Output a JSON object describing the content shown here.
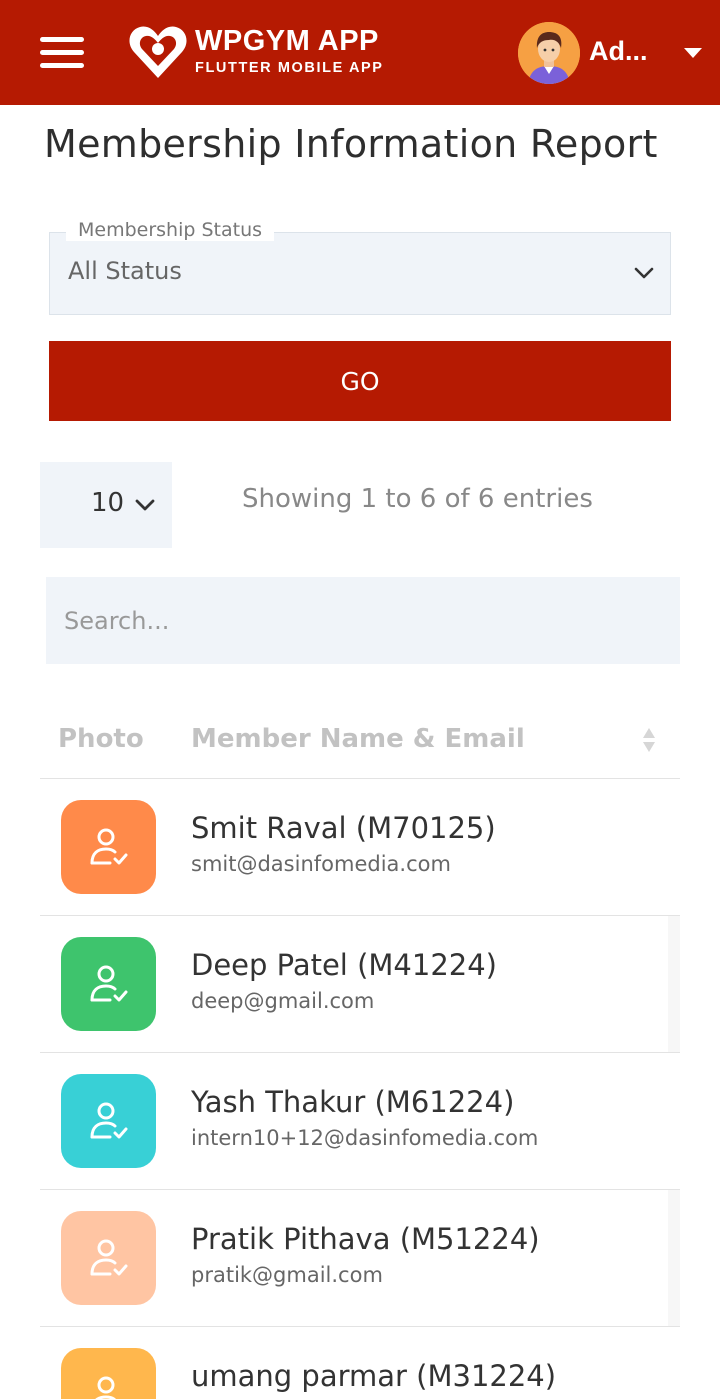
{
  "header": {
    "brand_title": "WPGYM APP",
    "brand_subtitle": "FLUTTER MOBILE APP",
    "user_name": "Ad...",
    "brand_color": "#b51a02"
  },
  "page": {
    "title": "Membership Information Report"
  },
  "filter": {
    "status_label": "Membership Status",
    "status_value": "All Status",
    "go_label": "GO"
  },
  "table_controls": {
    "page_length": "10",
    "showing_text": "Showing 1 to 6 of 6 entries",
    "search_placeholder": "Search..."
  },
  "table": {
    "columns": [
      "Photo",
      "Member Name & Email"
    ],
    "rows": [
      {
        "name": "Smit Raval (M70125)",
        "email": "smit@dasinfomedia.com",
        "color": "#ff8a4a",
        "icon": "user-check-icon"
      },
      {
        "name": "Deep Patel (M41224)",
        "email": "deep@gmail.com",
        "color": "#3ec46d",
        "icon": "user-check-icon"
      },
      {
        "name": "Yash Thakur (M61224)",
        "email": "intern10+12@dasinfomedia.com",
        "color": "#38d0d6",
        "icon": "user-check-icon"
      },
      {
        "name": "Pratik Pithava (M51224)",
        "email": "pratik@gmail.com",
        "color": "#ffc5a3",
        "icon": "user-check-icon"
      },
      {
        "name": "umang parmar (M31224)",
        "email": "",
        "color": "#ffb74d",
        "icon": "user-check-icon"
      }
    ]
  }
}
